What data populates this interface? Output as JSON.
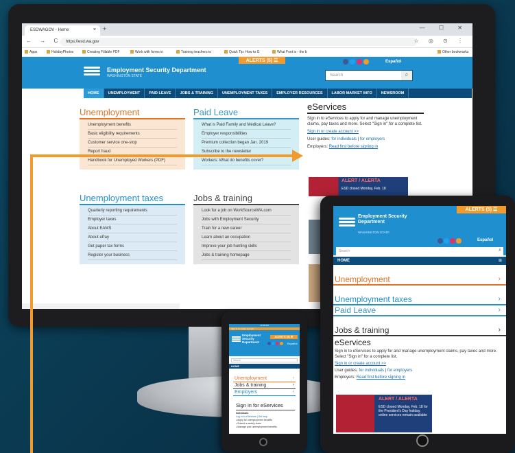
{
  "browser": {
    "tab_title": "ESDWAGOV - Home",
    "tab_close": "×",
    "new_tab": "+",
    "window_controls": "— ☐ ✕",
    "nav_icons": "← → C",
    "url": "https://esd.wa.gov",
    "right_icons": "☆ ◎ ⊙ ⋮",
    "bookmarks": [
      "Apps",
      "HolidayPhotos",
      "Creating Fillable PDF",
      "Work with forms in",
      "Training teachers to",
      "Quick Tip: How to G",
      "What Font is - the b",
      "Other bookmarks"
    ]
  },
  "site": {
    "org_name": "Employment Security Department",
    "org_sub": "WASHINGTON STATE",
    "alerts": "ALERTS (5) ☰",
    "espanol": "Español",
    "search_placeholder": "Search",
    "search_icon": "search-icon",
    "nav": [
      "HOME",
      "UNEMPLOYMENT",
      "PAID LEAVE",
      "JOBS & TRAINING",
      "UNEMPLOYMENT TAXES",
      "EMPLOYER RESOURCES",
      "LABOR MARKET INFO",
      "NEWSROOM"
    ],
    "colors": {
      "header": "#1f8fd0",
      "nav": "#0c4c7a",
      "accent": "#f29b2d",
      "orange": "#e37222",
      "teal": "#3a96b8"
    }
  },
  "blocks": {
    "unemployment": {
      "title": "Unemployment",
      "items": [
        "Unemployment benefits",
        "Basic eligibility requirements",
        "Customer service one-stop",
        "Report fraud",
        "Handbook for Unemployed Workers (PDF)"
      ]
    },
    "paid_leave": {
      "title": "Paid Leave",
      "items": [
        "What is Paid Family and Medical Leave?",
        "Employer responsibilities",
        "Premium collection began Jan. 2019",
        "Subscribe to the newsletter",
        "Workers: What do benefits cover?"
      ]
    },
    "unemployment_taxes": {
      "title": "Unemployment taxes",
      "items": [
        "Quarterly reporting requirements",
        "Employer taxes",
        "About EAMS",
        "About ePay",
        "Get paper tax forms",
        "Register your business"
      ]
    },
    "jobs_training": {
      "title": "Jobs & training",
      "items": [
        "Look for a job on WorkSourceWA.com",
        "Jobs with Employment Security",
        "Train for a new career",
        "Learn about an occupation",
        "Improve your job hunting skills",
        "Jobs & training homepage"
      ]
    }
  },
  "eservices": {
    "title": "eServices",
    "desc": "Sign in to eServices to apply for and manage unemployment claims, pay taxes and more. Select \"Sign in\" for a complete list.",
    "signin_link": "Sign in or create account >>",
    "guides_label": "User guides:",
    "guides_individuals": "for individuals",
    "guides_sep": "|",
    "guides_employers": "for employers",
    "employers_label": "Employers:",
    "employers_link": "Read first before signing in"
  },
  "banner": {
    "title": "ALERT / ALERTA",
    "line1": "ESD closed Monday, Feb. 18",
    "line2": "for the President's Day holiday,",
    "line3": "online services remain available"
  },
  "tablet": {
    "alerts": "ALERTS (5) ☰",
    "org_name": "Employment Security Department",
    "org_sub": "WASHINGTON STATE",
    "espanol": "Español",
    "search_placeholder": "Search",
    "home": "HOME",
    "sections": [
      "Unemployment",
      "Unemployment taxes",
      "Paid Leave",
      "Jobs & training"
    ],
    "eservices_title": "eServices",
    "eservices_desc": "Sign in to eServices to apply for and manage unemployment claims, pay taxes and more. Select \"Sign in\" for a complete list.",
    "signin_link": "Sign in or create account >>",
    "guides_label": "User guides:",
    "guides_individuals": "for individuals",
    "guides_employers": "for employers",
    "employers_label": "Employers:",
    "employers_link": "Read first before signing in"
  },
  "phone": {
    "status_time": "11:48 AM",
    "alert_strip": "Sign in or create account",
    "org_name": "Employment Security Department",
    "alerts": "ALERTS (5) ☰",
    "espanol": "Español",
    "search_placeholder": "Search",
    "home": "HOME",
    "sections": [
      "Unemployment",
      "Jobs & training",
      "Employers"
    ],
    "signin_title": "Sign in for eServices",
    "individuals": "Individuals",
    "individuals_link": "Log in to eServices | Get help",
    "bullets": [
      "Apply for unemployment benefits",
      "Submit a weekly claim",
      "Manage your unemployment benefits"
    ]
  }
}
